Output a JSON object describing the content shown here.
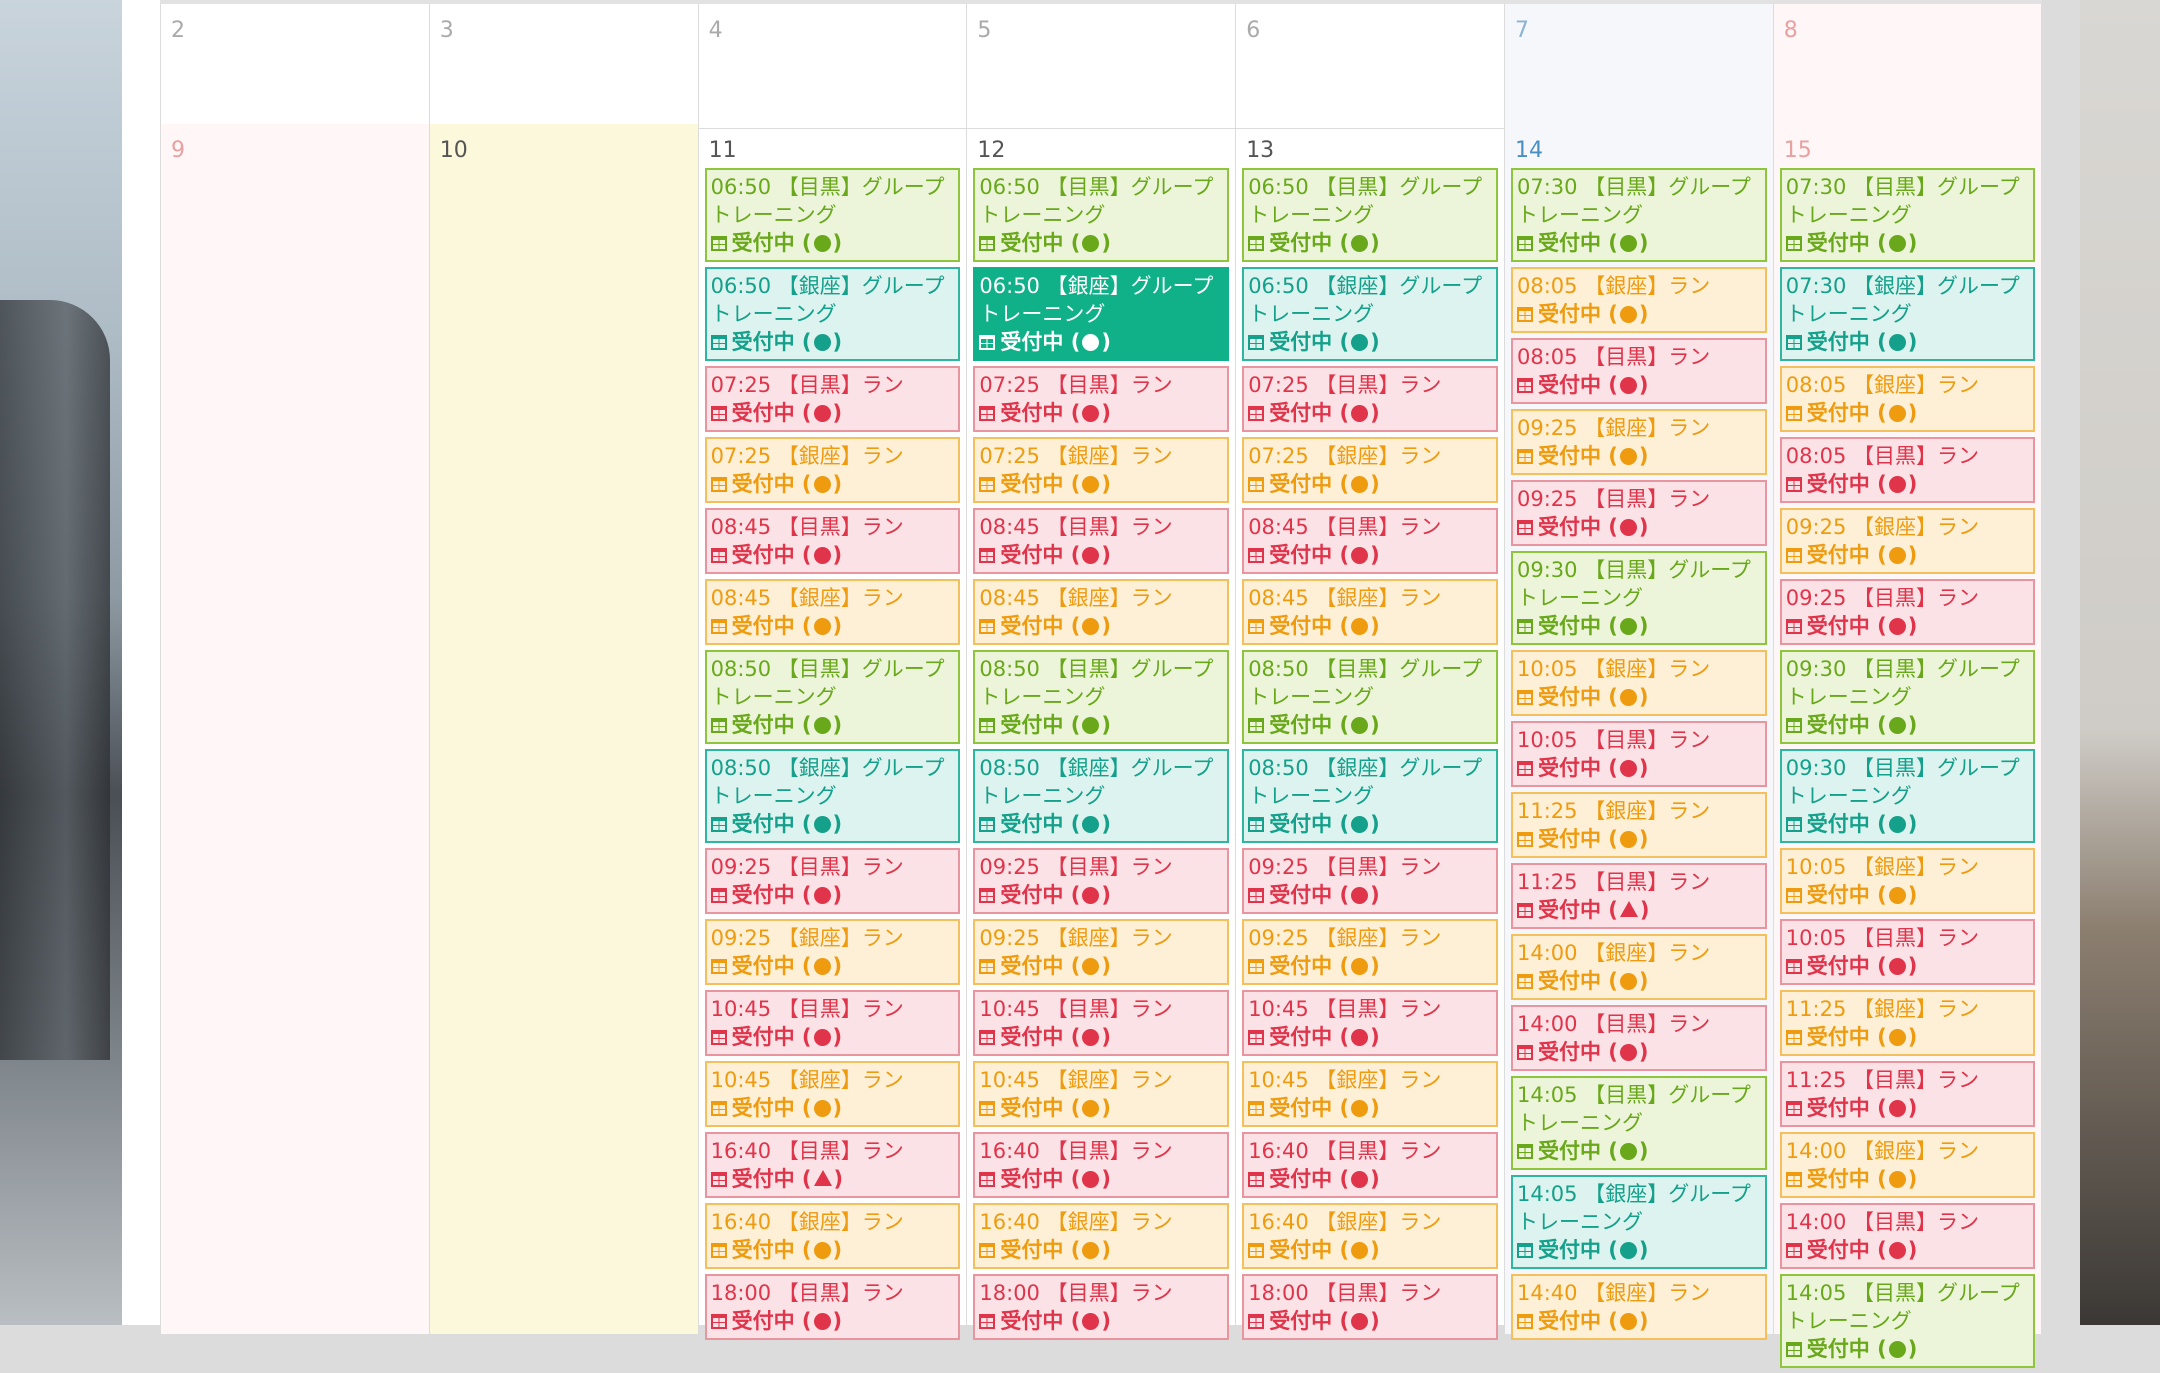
{
  "calendar": {
    "week1": [
      {
        "day": "2",
        "kind": "mute"
      },
      {
        "day": "3",
        "kind": "mute"
      },
      {
        "day": "4",
        "kind": "mute"
      },
      {
        "day": "5",
        "kind": "mute"
      },
      {
        "day": "6",
        "kind": "mute"
      },
      {
        "day": "7",
        "kind": "sat"
      },
      {
        "day": "8",
        "kind": "sun"
      }
    ],
    "week2": [
      {
        "day": "9",
        "kind": "sun",
        "events": []
      },
      {
        "day": "10",
        "kind": "today",
        "events": []
      },
      {
        "day": "11",
        "kind": "normal",
        "events": [
          {
            "title": "06:50 【目黒】グループトレーニング",
            "status": "受付中",
            "color": "green",
            "mark": "circle"
          },
          {
            "title": "06:50 【銀座】グループトレーニング",
            "status": "受付中",
            "color": "teal",
            "mark": "circle"
          },
          {
            "title": "07:25 【目黒】ラン",
            "status": "受付中",
            "color": "red",
            "mark": "circle"
          },
          {
            "title": "07:25 【銀座】ラン",
            "status": "受付中",
            "color": "orange",
            "mark": "circle"
          },
          {
            "title": "08:45 【目黒】ラン",
            "status": "受付中",
            "color": "red",
            "mark": "circle"
          },
          {
            "title": "08:45 【銀座】ラン",
            "status": "受付中",
            "color": "orange",
            "mark": "circle"
          },
          {
            "title": "08:50 【目黒】グループトレーニング",
            "status": "受付中",
            "color": "green",
            "mark": "circle"
          },
          {
            "title": "08:50 【銀座】グループトレーニング",
            "status": "受付中",
            "color": "teal",
            "mark": "circle"
          },
          {
            "title": "09:25 【目黒】ラン",
            "status": "受付中",
            "color": "red",
            "mark": "circle"
          },
          {
            "title": "09:25 【銀座】ラン",
            "status": "受付中",
            "color": "orange",
            "mark": "circle"
          },
          {
            "title": "10:45 【目黒】ラン",
            "status": "受付中",
            "color": "red",
            "mark": "circle"
          },
          {
            "title": "10:45 【銀座】ラン",
            "status": "受付中",
            "color": "orange",
            "mark": "circle"
          },
          {
            "title": "16:40 【目黒】ラン",
            "status": "受付中",
            "color": "red",
            "mark": "triangle"
          },
          {
            "title": "16:40 【銀座】ラン",
            "status": "受付中",
            "color": "orange",
            "mark": "circle"
          },
          {
            "title": "18:00 【目黒】ラン",
            "status": "受付中",
            "color": "red",
            "mark": "circle"
          }
        ]
      },
      {
        "day": "12",
        "kind": "normal",
        "events": [
          {
            "title": "06:50 【目黒】グループトレーニング",
            "status": "受付中",
            "color": "green",
            "mark": "circle"
          },
          {
            "title": "06:50 【銀座】グループトレーニング",
            "status": "受付中",
            "color": "sel",
            "mark": "circle"
          },
          {
            "title": "07:25 【目黒】ラン",
            "status": "受付中",
            "color": "red",
            "mark": "circle"
          },
          {
            "title": "07:25 【銀座】ラン",
            "status": "受付中",
            "color": "orange",
            "mark": "circle"
          },
          {
            "title": "08:45 【目黒】ラン",
            "status": "受付中",
            "color": "red",
            "mark": "circle"
          },
          {
            "title": "08:45 【銀座】ラン",
            "status": "受付中",
            "color": "orange",
            "mark": "circle"
          },
          {
            "title": "08:50 【目黒】グループトレーニング",
            "status": "受付中",
            "color": "green",
            "mark": "circle"
          },
          {
            "title": "08:50 【銀座】グループトレーニング",
            "status": "受付中",
            "color": "teal",
            "mark": "circle"
          },
          {
            "title": "09:25 【目黒】ラン",
            "status": "受付中",
            "color": "red",
            "mark": "circle"
          },
          {
            "title": "09:25 【銀座】ラン",
            "status": "受付中",
            "color": "orange",
            "mark": "circle"
          },
          {
            "title": "10:45 【目黒】ラン",
            "status": "受付中",
            "color": "red",
            "mark": "circle"
          },
          {
            "title": "10:45 【銀座】ラン",
            "status": "受付中",
            "color": "orange",
            "mark": "circle"
          },
          {
            "title": "16:40 【目黒】ラン",
            "status": "受付中",
            "color": "red",
            "mark": "circle"
          },
          {
            "title": "16:40 【銀座】ラン",
            "status": "受付中",
            "color": "orange",
            "mark": "circle"
          },
          {
            "title": "18:00 【目黒】ラン",
            "status": "受付中",
            "color": "red",
            "mark": "circle"
          }
        ]
      },
      {
        "day": "13",
        "kind": "normal",
        "events": [
          {
            "title": "06:50 【目黒】グループトレーニング",
            "status": "受付中",
            "color": "green",
            "mark": "circle"
          },
          {
            "title": "06:50 【銀座】グループトレーニング",
            "status": "受付中",
            "color": "teal",
            "mark": "circle"
          },
          {
            "title": "07:25 【目黒】ラン",
            "status": "受付中",
            "color": "red",
            "mark": "circle"
          },
          {
            "title": "07:25 【銀座】ラン",
            "status": "受付中",
            "color": "orange",
            "mark": "circle"
          },
          {
            "title": "08:45 【目黒】ラン",
            "status": "受付中",
            "color": "red",
            "mark": "circle"
          },
          {
            "title": "08:45 【銀座】ラン",
            "status": "受付中",
            "color": "orange",
            "mark": "circle"
          },
          {
            "title": "08:50 【目黒】グループトレーニング",
            "status": "受付中",
            "color": "green",
            "mark": "circle"
          },
          {
            "title": "08:50 【銀座】グループトレーニング",
            "status": "受付中",
            "color": "teal",
            "mark": "circle"
          },
          {
            "title": "09:25 【目黒】ラン",
            "status": "受付中",
            "color": "red",
            "mark": "circle"
          },
          {
            "title": "09:25 【銀座】ラン",
            "status": "受付中",
            "color": "orange",
            "mark": "circle"
          },
          {
            "title": "10:45 【目黒】ラン",
            "status": "受付中",
            "color": "red",
            "mark": "circle"
          },
          {
            "title": "10:45 【銀座】ラン",
            "status": "受付中",
            "color": "orange",
            "mark": "circle"
          },
          {
            "title": "16:40 【目黒】ラン",
            "status": "受付中",
            "color": "red",
            "mark": "circle"
          },
          {
            "title": "16:40 【銀座】ラン",
            "status": "受付中",
            "color": "orange",
            "mark": "circle"
          },
          {
            "title": "18:00 【目黒】ラン",
            "status": "受付中",
            "color": "red",
            "mark": "circle"
          }
        ]
      },
      {
        "day": "14",
        "kind": "sat",
        "events": [
          {
            "title": "07:30 【目黒】グループトレーニング",
            "status": "受付中",
            "color": "green",
            "mark": "circle"
          },
          {
            "title": "08:05 【銀座】ラン",
            "status": "受付中",
            "color": "orange",
            "mark": "circle"
          },
          {
            "title": "08:05 【目黒】ラン",
            "status": "受付中",
            "color": "red",
            "mark": "circle"
          },
          {
            "title": "09:25 【銀座】ラン",
            "status": "受付中",
            "color": "orange",
            "mark": "circle"
          },
          {
            "title": "09:25 【目黒】ラン",
            "status": "受付中",
            "color": "red",
            "mark": "circle"
          },
          {
            "title": "09:30 【目黒】グループトレーニング",
            "status": "受付中",
            "color": "green",
            "mark": "circle"
          },
          {
            "title": "10:05 【銀座】ラン",
            "status": "受付中",
            "color": "orange",
            "mark": "circle"
          },
          {
            "title": "10:05 【目黒】ラン",
            "status": "受付中",
            "color": "red",
            "mark": "circle"
          },
          {
            "title": "11:25 【銀座】ラン",
            "status": "受付中",
            "color": "orange",
            "mark": "circle"
          },
          {
            "title": "11:25 【目黒】ラン",
            "status": "受付中",
            "color": "red",
            "mark": "triangle"
          },
          {
            "title": "14:00 【銀座】ラン",
            "status": "受付中",
            "color": "orange",
            "mark": "circle"
          },
          {
            "title": "14:00 【目黒】ラン",
            "status": "受付中",
            "color": "red",
            "mark": "circle"
          },
          {
            "title": "14:05 【目黒】グループトレーニング",
            "status": "受付中",
            "color": "green",
            "mark": "circle"
          },
          {
            "title": "14:05 【銀座】グループトレーニング",
            "status": "受付中",
            "color": "teal",
            "mark": "circle"
          },
          {
            "title": "14:40 【銀座】ラン",
            "status": "受付中",
            "color": "orange",
            "mark": "circle"
          }
        ]
      },
      {
        "day": "15",
        "kind": "sun",
        "events": [
          {
            "title": "07:30 【目黒】グループトレーニング",
            "status": "受付中",
            "color": "green",
            "mark": "circle"
          },
          {
            "title": "07:30 【銀座】グループトレーニング",
            "status": "受付中",
            "color": "teal",
            "mark": "circle"
          },
          {
            "title": "08:05 【銀座】ラン",
            "status": "受付中",
            "color": "orange",
            "mark": "circle"
          },
          {
            "title": "08:05 【目黒】ラン",
            "status": "受付中",
            "color": "red",
            "mark": "circle"
          },
          {
            "title": "09:25 【銀座】ラン",
            "status": "受付中",
            "color": "orange",
            "mark": "circle"
          },
          {
            "title": "09:25 【目黒】ラン",
            "status": "受付中",
            "color": "red",
            "mark": "circle"
          },
          {
            "title": "09:30 【目黒】グループトレーニング",
            "status": "受付中",
            "color": "green",
            "mark": "circle"
          },
          {
            "title": "09:30 【目黒】グループトレーニング",
            "status": "受付中",
            "color": "teal",
            "mark": "circle"
          },
          {
            "title": "10:05 【銀座】ラン",
            "status": "受付中",
            "color": "orange",
            "mark": "circle"
          },
          {
            "title": "10:05 【目黒】ラン",
            "status": "受付中",
            "color": "red",
            "mark": "circle"
          },
          {
            "title": "11:25 【銀座】ラン",
            "status": "受付中",
            "color": "orange",
            "mark": "circle"
          },
          {
            "title": "11:25 【目黒】ラン",
            "status": "受付中",
            "color": "red",
            "mark": "circle"
          },
          {
            "title": "14:00 【銀座】ラン",
            "status": "受付中",
            "color": "orange",
            "mark": "circle"
          },
          {
            "title": "14:00 【目黒】ラン",
            "status": "受付中",
            "color": "red",
            "mark": "circle"
          },
          {
            "title": "14:05 【目黒】グループトレーニング",
            "status": "受付中",
            "color": "green",
            "mark": "circle"
          }
        ]
      }
    ]
  }
}
